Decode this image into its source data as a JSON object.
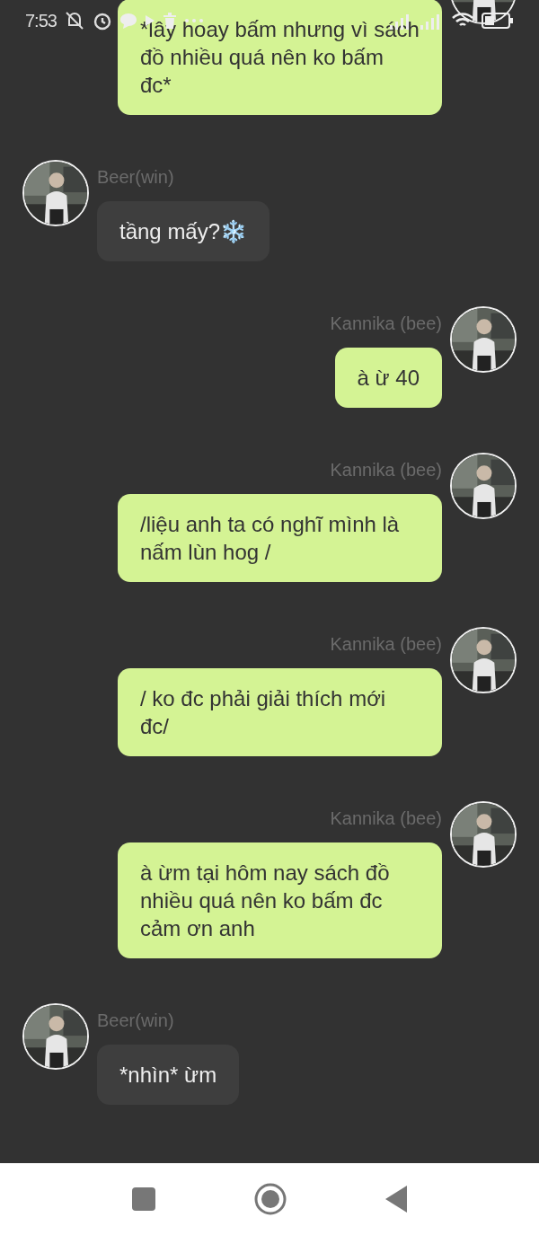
{
  "status_bar": {
    "time": "7:53"
  },
  "messages": [
    {
      "kind": "sent",
      "text": "*lây hoay bấm nhưng vì sách đồ nhiều quá nên ko bấm đc*"
    },
    {
      "kind": "received",
      "sender": "Beer(win)",
      "text": "tầng mấy?❄️"
    },
    {
      "kind": "sent",
      "sender": "Kannika (bee)",
      "text": "à ừ 40"
    },
    {
      "kind": "sent",
      "sender": "Kannika (bee)",
      "text": "/liệu anh ta có nghĩ mình là nấm lùn hog /"
    },
    {
      "kind": "sent",
      "sender": "Kannika (bee)",
      "text": "/ ko đc phải giải thích mới đc/"
    },
    {
      "kind": "sent",
      "sender": "Kannika (bee)",
      "text": "à ừm tại hôm nay sách đồ nhiều quá nên ko bấm đc cảm ơn anh"
    },
    {
      "kind": "received",
      "sender": "Beer(win)",
      "text": "*nhìn* ừm"
    }
  ]
}
